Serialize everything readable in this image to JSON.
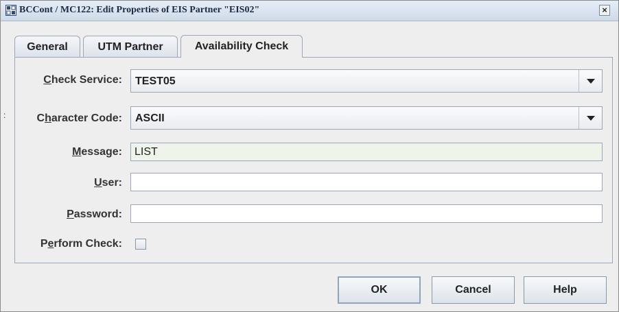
{
  "window": {
    "title": "BCCont / MC122: Edit Properties of EIS Partner \"EIS02\"",
    "close_label": "×"
  },
  "tabs": [
    {
      "label": "General",
      "active": false
    },
    {
      "label": "UTM Partner",
      "active": false
    },
    {
      "label": "Availability Check",
      "active": true
    }
  ],
  "form": {
    "check_service": {
      "label_pre": "",
      "label_mn": "C",
      "label_post": "heck Service:",
      "value": "TEST05"
    },
    "character_code": {
      "label_pre": "C",
      "label_mn": "h",
      "label_post": "aracter Code:",
      "value": "ASCII"
    },
    "message": {
      "label_pre": "",
      "label_mn": "M",
      "label_post": "essage:",
      "value": "LIST"
    },
    "user": {
      "label_pre": "",
      "label_mn": "U",
      "label_post": "ser:",
      "value": ""
    },
    "password": {
      "label_pre": "",
      "label_mn": "P",
      "label_post": "assword:",
      "value": ""
    },
    "perform_check": {
      "label_pre": "P",
      "label_mn": "e",
      "label_post": "rform Check:",
      "checked": false
    }
  },
  "buttons": {
    "ok": "OK",
    "cancel": "Cancel",
    "help": "Help"
  },
  "side_mark": ":"
}
